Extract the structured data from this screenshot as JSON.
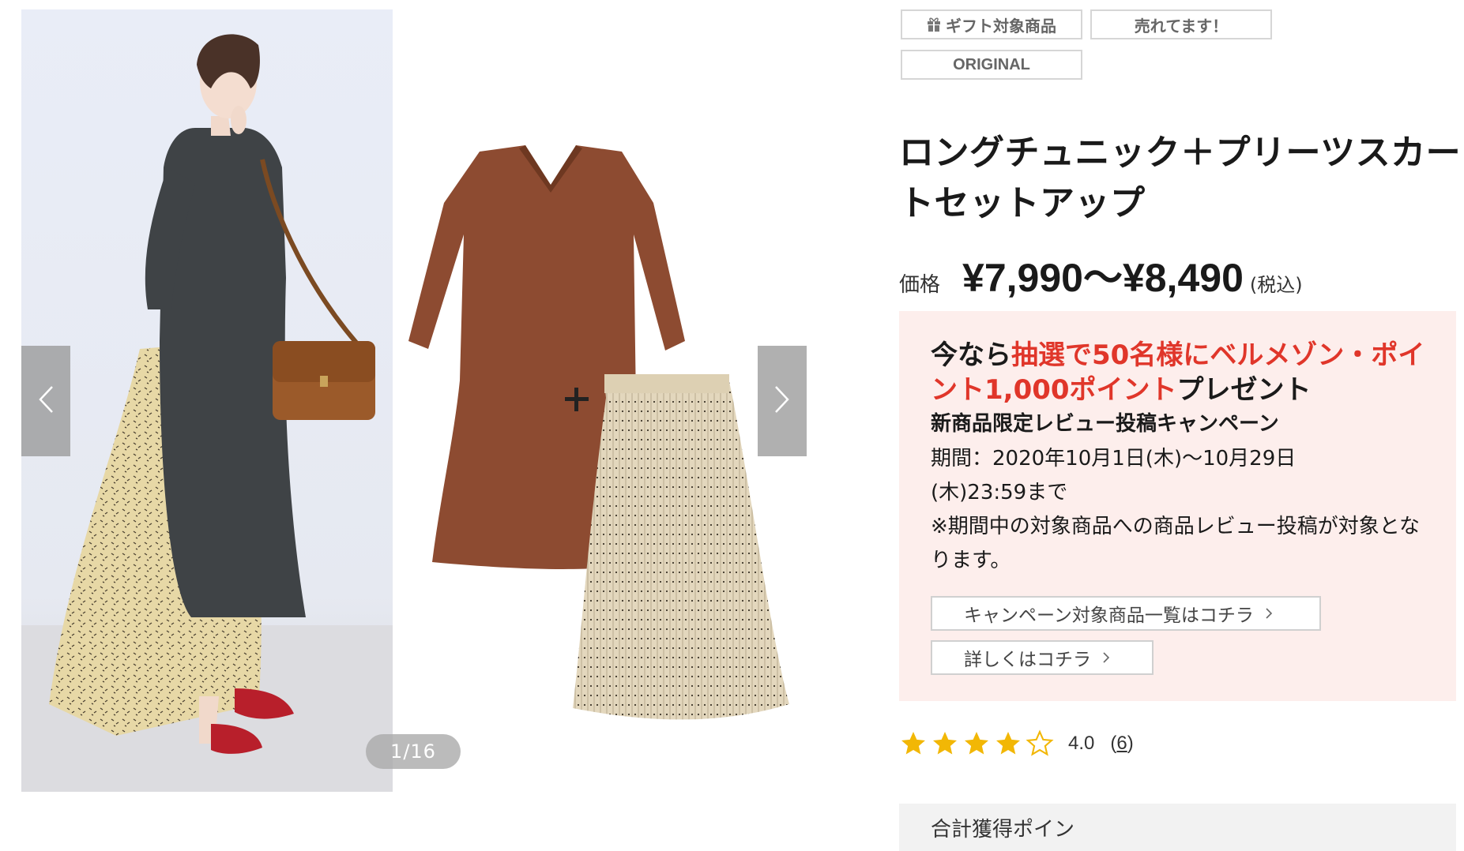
{
  "gallery": {
    "counter": "1/16",
    "prev_icon": "chevron-left-icon",
    "next_icon": "chevron-right-icon"
  },
  "tags": {
    "gift": "ギフト対象商品",
    "gift_icon": "gift-icon",
    "selling": "売れてます！",
    "original": "ORIGINAL"
  },
  "product": {
    "title": "ロングチュニック＋プリーツスカートセットアップ",
    "price_label": "価格",
    "price": "¥7,990〜¥8,490",
    "tax": "(税込)"
  },
  "campaign": {
    "headline_prefix": "今なら",
    "headline_highlight": "抽選で50名様にベルメゾン・ポイント1,000ポイント",
    "headline_suffix": "プレゼント",
    "subtitle": "新商品限定レビュー投稿キャンペーン",
    "period": "期間：2020年10月1日(木)〜10月29日(木)23:59まで",
    "note": "※期間中の対象商品への商品レビュー投稿が対象となります。",
    "link_products": "キャンペーン対象商品一覧はコチラ",
    "link_details": "詳しくはコチラ",
    "highlight_color": "#e0362a",
    "background_color": "#fdeeec"
  },
  "rating": {
    "stars_filled": 4,
    "stars_total": 5,
    "value": "4.0",
    "count_open": "(",
    "count": "6",
    "count_close": ")",
    "star_color": "#f2b705"
  },
  "points": {
    "label": "合計獲得ポイン"
  }
}
